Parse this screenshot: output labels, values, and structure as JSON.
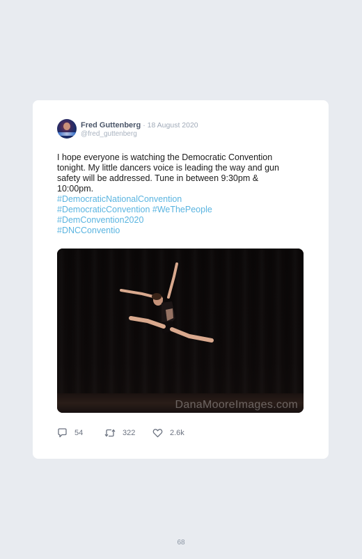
{
  "tweet": {
    "author_name": "Fred Guttenberg",
    "date": "· 18 August 2020",
    "handle": "@fred_guttenberg",
    "text": "I hope everyone is watching the Democratic Convention tonight. My little dancers voice is leading the way and gun safety will be addressed. Tune in between 9:30pm & 10:00pm.",
    "hashtags": [
      "#DemocraticNationalConvention",
      "#DemocraticConvention #WeThePeople",
      "#DemConvention2020",
      "#DNCConventio"
    ],
    "image_watermark": "DanaMooreImages.com",
    "stats": {
      "replies": "54",
      "retweets": "322",
      "likes": "2.6k"
    }
  },
  "page_number": "68",
  "icons": [
    "reply-icon",
    "retweet-icon",
    "like-icon"
  ],
  "colors": {
    "background": "#e8ebf0",
    "card": "#ffffff",
    "hashtag": "#5ab4e0",
    "muted": "#a0aab8"
  }
}
